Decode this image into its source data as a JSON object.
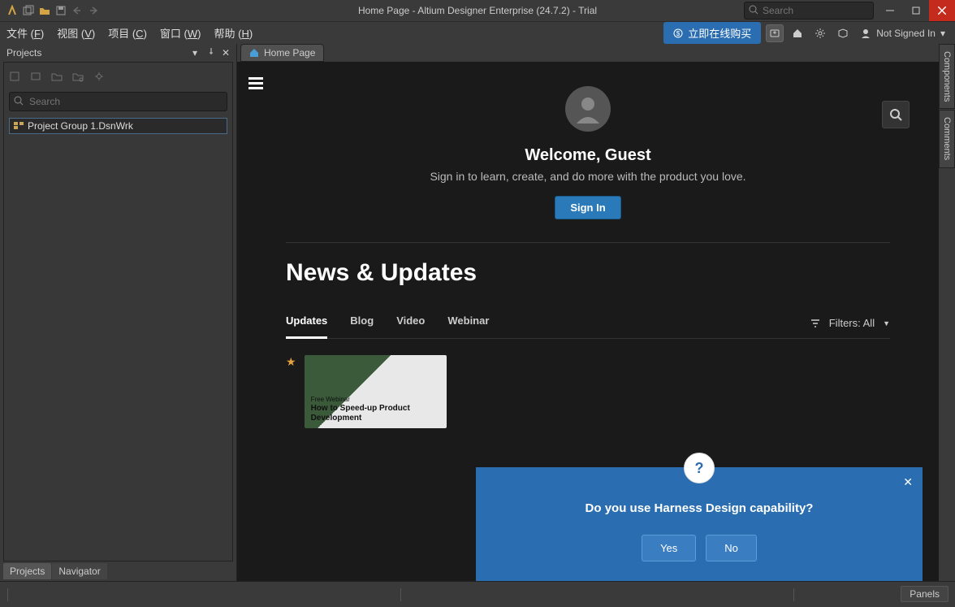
{
  "titlebar": {
    "title": "Home Page - Altium Designer Enterprise (24.7.2) - Trial"
  },
  "top_search": {
    "placeholder": "Search"
  },
  "menu": {
    "items": [
      {
        "label": "文件",
        "accel": "F"
      },
      {
        "label": "视图",
        "accel": "V"
      },
      {
        "label": "项目",
        "accel": "C"
      },
      {
        "label": "窗口",
        "accel": "W"
      },
      {
        "label": "帮助",
        "accel": "H"
      }
    ],
    "buy_label": "立即在线购买",
    "not_signed": "Not Signed In"
  },
  "projects_panel": {
    "title": "Projects",
    "search_placeholder": "Search",
    "item": "Project Group 1.DsnWrk"
  },
  "bottom_tabs": {
    "projects": "Projects",
    "navigator": "Navigator"
  },
  "side_tabs": {
    "components": "Components",
    "comments": "Comments"
  },
  "tab": {
    "label": "Home Page"
  },
  "home": {
    "welcome_title": "Welcome, Guest",
    "welcome_sub": "Sign in to learn, create, and do more with the product you love.",
    "signin": "Sign In",
    "news_title": "News & Updates",
    "tabs": {
      "updates": "Updates",
      "blog": "Blog",
      "video": "Video",
      "webinar": "Webinar"
    },
    "filters_label": "Filters: All",
    "card_overlay": "Free Webinar",
    "card_title": "How to Speed-up Product Development"
  },
  "popup": {
    "question": "Do you use Harness Design capability?",
    "yes": "Yes",
    "no": "No"
  },
  "panels_btn": "Panels"
}
